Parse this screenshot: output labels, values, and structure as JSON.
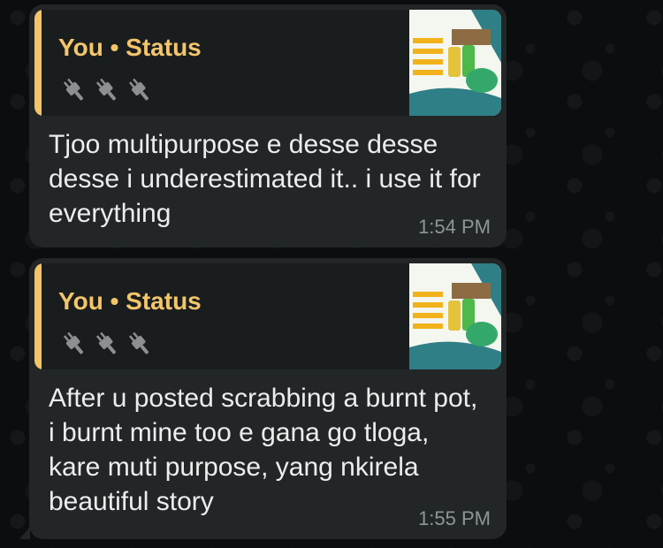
{
  "messages": [
    {
      "quote": {
        "title": "You • Status",
        "icons": [
          "plug-icon",
          "plug-icon",
          "plug-icon"
        ]
      },
      "text": "Tjoo multipurpose e desse desse desse i underestimated it.. i use it for everything",
      "time": "1:54 PM"
    },
    {
      "quote": {
        "title": "You • Status",
        "icons": [
          "plug-icon",
          "plug-icon",
          "plug-icon"
        ]
      },
      "text": "After u posted scrabbing a burnt pot, i burnt mine too e gana go tloga, kare muti purpose, yang nkirela beautiful story",
      "time": "1:55 PM"
    }
  ],
  "colors": {
    "quote_accent": "#f3c56b",
    "bubble": "#222627",
    "text": "#eceeee",
    "time": "#8f9597"
  }
}
